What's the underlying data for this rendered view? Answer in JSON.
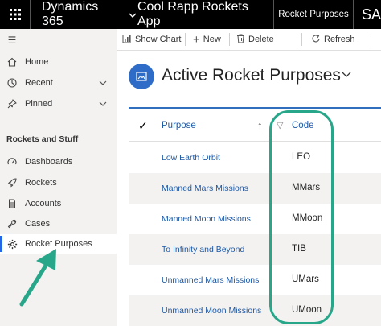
{
  "topbar": {
    "grid_icon": "app-grid-icon",
    "app_name": "Dynamics 365",
    "app_chevron": "⌄",
    "app_title": "Cool Rapp Rockets App",
    "area": "Rocket Purposes",
    "search_text": "SA"
  },
  "sidebar": {
    "hamburger": "☰",
    "top_items": [
      {
        "label": "Home",
        "icon": "home-icon"
      },
      {
        "label": "Recent",
        "icon": "clock-icon"
      },
      {
        "label": "Pinned",
        "icon": "pin-icon"
      }
    ],
    "section_title": "Rockets and Stuff",
    "items": [
      {
        "label": "Dashboards",
        "icon": "dashboard-icon"
      },
      {
        "label": "Rockets",
        "icon": "rocket-icon"
      },
      {
        "label": "Accounts",
        "icon": "document-icon"
      },
      {
        "label": "Cases",
        "icon": "wrench-icon"
      },
      {
        "label": "Rocket Purposes",
        "icon": "gear-icon"
      }
    ],
    "selected": "Rocket Purposes"
  },
  "commandbar": {
    "show_chart": "Show Chart",
    "new": "New",
    "delete": "Delete",
    "refresh": "Refresh"
  },
  "view": {
    "title": "Active Rocket Purposes"
  },
  "grid": {
    "columns": [
      "Purpose",
      "Code"
    ],
    "rows": [
      {
        "purpose": "Low Earth Orbit",
        "code": "LEO"
      },
      {
        "purpose": "Manned Mars Missions",
        "code": "MMars"
      },
      {
        "purpose": "Manned Moon Missions",
        "code": "MMoon"
      },
      {
        "purpose": "To Infinity and Beyond",
        "code": "TIB"
      },
      {
        "purpose": "Unmanned Mars Missions",
        "code": "UMars"
      },
      {
        "purpose": "Unmanned Moon Missions",
        "code": "UMoon"
      }
    ]
  },
  "colors": {
    "accent": "#2266e3",
    "annotation": "#28a68a",
    "link": "#1f5aa6"
  }
}
